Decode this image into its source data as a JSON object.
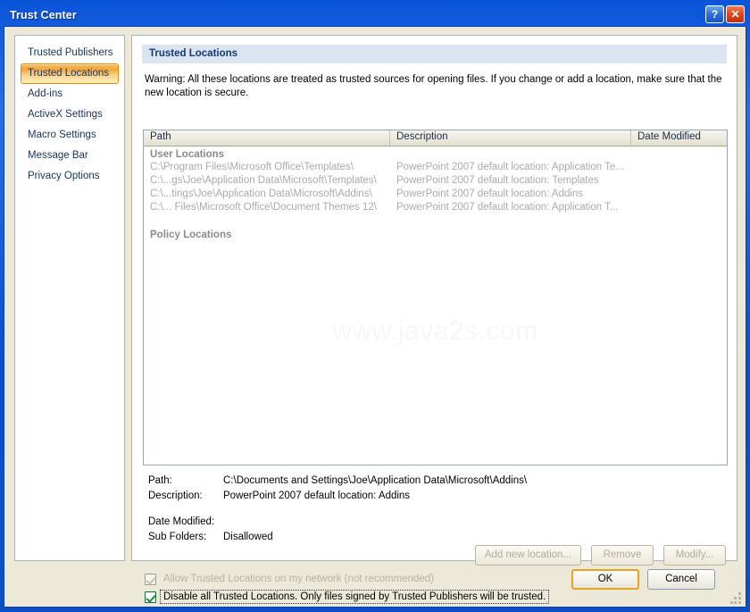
{
  "window": {
    "title": "Trust Center",
    "help_button": "?",
    "close_button": "✕",
    "help_icon_name": "help-icon",
    "close_icon_name": "close-icon"
  },
  "sidebar": {
    "items": [
      {
        "label": "Trusted Publishers",
        "selected": false
      },
      {
        "label": "Trusted Locations",
        "selected": true
      },
      {
        "label": "Add-ins",
        "selected": false
      },
      {
        "label": "ActiveX Settings",
        "selected": false
      },
      {
        "label": "Macro Settings",
        "selected": false
      },
      {
        "label": "Message Bar",
        "selected": false
      },
      {
        "label": "Privacy Options",
        "selected": false
      }
    ]
  },
  "main": {
    "section_header": "Trusted Locations",
    "warning": "Warning: All these locations are treated as trusted sources for opening files.  If you change or add a location, make sure that the new location is secure.",
    "watermark": "www.java2s.com"
  },
  "listview": {
    "columns": [
      {
        "label": "Path"
      },
      {
        "label": "Description"
      },
      {
        "label": "Date Modified"
      }
    ],
    "groups": [
      {
        "name": "User Locations",
        "rows": [
          {
            "path": "C:\\Program Files\\Microsoft Office\\Templates\\",
            "description": "PowerPoint 2007 default location: Application Te...",
            "date_modified": ""
          },
          {
            "path": "C:\\...gs\\Joe\\Application Data\\Microsoft\\Templates\\",
            "description": "PowerPoint 2007 default location: Templates",
            "date_modified": ""
          },
          {
            "path": "C:\\...tings\\Joe\\Application Data\\Microsoft\\Addins\\",
            "description": "PowerPoint 2007 default location: Addins",
            "date_modified": ""
          },
          {
            "path": "C:\\... Files\\Microsoft Office\\Document Themes 12\\",
            "description": "PowerPoint 2007 default location: Application T...",
            "date_modified": ""
          }
        ]
      },
      {
        "name": "Policy Locations",
        "rows": []
      }
    ]
  },
  "details": {
    "path_label": "Path:",
    "path_value": "C:\\Documents and Settings\\Joe\\Application Data\\Microsoft\\Addins\\",
    "description_label": "Description:",
    "description_value": "PowerPoint 2007 default location: Addins",
    "date_modified_label": "Date Modified:",
    "date_modified_value": "",
    "sub_folders_label": "Sub Folders:",
    "sub_folders_value": "Disallowed"
  },
  "action_buttons": {
    "add": "Add new location...",
    "remove": "Remove",
    "modify": "Modify..."
  },
  "checkboxes": [
    {
      "label": "Allow Trusted Locations on my network (not recommended)",
      "checked": true,
      "enabled": false,
      "focused": false
    },
    {
      "label": "Disable all Trusted Locations. Only files signed by Trusted Publishers will be trusted.",
      "checked": true,
      "enabled": true,
      "focused": true
    }
  ],
  "footer": {
    "ok": "OK",
    "cancel": "Cancel"
  },
  "colors": {
    "titlebar_blue": "#0b52d4",
    "dialog_face": "#ece9d8",
    "selected_orange": "#f5a63a",
    "section_header_bg": "#dbe4f1",
    "header_text": "#153a76",
    "disabled_text": "#aaaaaa",
    "check_green": "#168a3a",
    "default_button_border": "#e6a320"
  }
}
